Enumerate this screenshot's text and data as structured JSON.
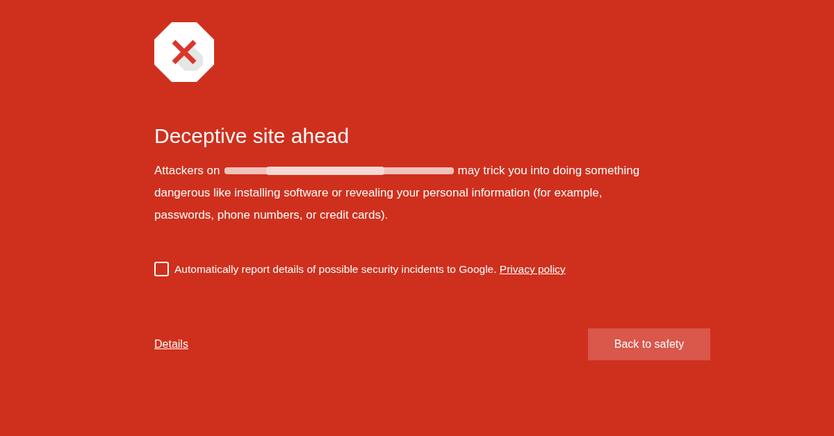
{
  "heading": "Deceptive site ahead",
  "message": {
    "before": "Attackers on",
    "lines": [
      "may trick you into doing something",
      "dangerous like installing software or revealing your personal information (for example,",
      "passwords, phone numbers, or credit cards)."
    ]
  },
  "report": {
    "checked": false,
    "label": "Automatically report details of possible security incidents to Google.",
    "link": "Privacy policy"
  },
  "details_link": "Details",
  "button": "Back to safety"
}
